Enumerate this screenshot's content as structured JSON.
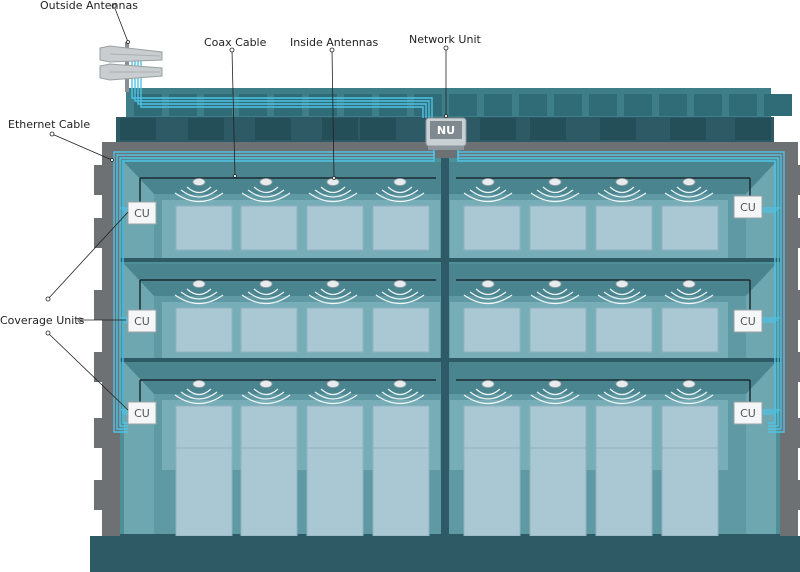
{
  "labels": {
    "outside_antennas": "Outside Antennas",
    "coax_cable": "Coax Cable",
    "inside_antennas": "Inside Antennas",
    "network_unit": "Network Unit",
    "ethernet_cable": "Ethernet Cable",
    "coverage_units": "Coverage Units"
  },
  "units": {
    "network_unit": "NU",
    "coverage_unit": "CU"
  },
  "colors": {
    "building_dark": "#2e5a66",
    "building_frame": "#6e7173",
    "interior": "#5f9aa4",
    "window": "#a9c8d4",
    "ethernet": "#4ec3e6",
    "coax": "#1b2b30",
    "background": "#ffffff"
  }
}
